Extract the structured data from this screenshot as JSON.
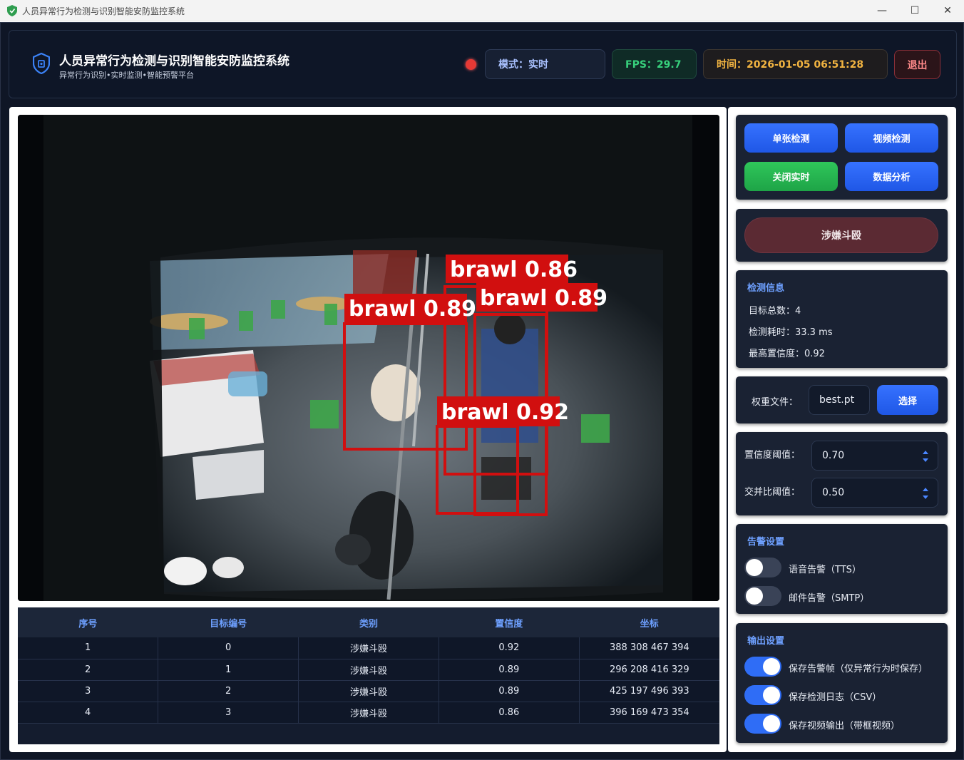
{
  "window": {
    "title": "人员异常行为检测与识别智能安防监控系统",
    "minimize_glyph": "—",
    "maximize_glyph": "☐",
    "close_glyph": "✕"
  },
  "header": {
    "title": "人员异常行为检测与识别智能安防监控系统",
    "subtitle": "异常行为识别•实时监测•智能预警平台",
    "mode": "模式：实时",
    "fps": "FPS：29.7",
    "time": "时间：2026-01-05 06:51:28",
    "exit_label": "退出"
  },
  "video": {
    "detections": [
      {
        "label": "brawl 0.86"
      },
      {
        "label": "brawl 0.89"
      },
      {
        "label": "brawl 0.89"
      },
      {
        "label": "brawl 0.92"
      }
    ]
  },
  "table": {
    "headers": [
      "序号",
      "目标编号",
      "类别",
      "置信度",
      "坐标"
    ],
    "rows": [
      [
        "1",
        "0",
        "涉嫌斗殴",
        "0.92",
        "388 308 467 394"
      ],
      [
        "2",
        "1",
        "涉嫌斗殴",
        "0.89",
        "296 208 416 329"
      ],
      [
        "3",
        "2",
        "涉嫌斗殴",
        "0.89",
        "425 197 496 393"
      ],
      [
        "4",
        "3",
        "涉嫌斗殴",
        "0.86",
        "396 169 473 354"
      ]
    ]
  },
  "controls": {
    "single_detect": "单张检测",
    "video_detect": "视频检测",
    "close_realtime": "关闭实时",
    "data_analysis": "数据分析"
  },
  "alarm": {
    "text": "涉嫌斗殴"
  },
  "detection_info": {
    "title": "检测信息",
    "total": "目标总数：4",
    "elapsed": "检测耗时：33.3 ms",
    "max_conf": "最高置信度：0.92"
  },
  "weights": {
    "label": "权重文件：",
    "value": "best.pt",
    "choose": "选择"
  },
  "thresholds": {
    "conf_label": "置信度阈值：",
    "conf_value": "0.70",
    "iou_label": "交并比阈值：",
    "iou_value": "0.50"
  },
  "alert_settings": {
    "title": "告警设置",
    "items": [
      {
        "label": "语音告警（TTS）",
        "enabled": false
      },
      {
        "label": "邮件告警（SMTP）",
        "enabled": false
      }
    ]
  },
  "output_settings": {
    "title": "输出设置",
    "items": [
      {
        "label": "保存告警帧（仅异常行为时保存）",
        "enabled": true
      },
      {
        "label": "保存检测日志（CSV）",
        "enabled": true
      },
      {
        "label": "保存视频输出（带框视频）",
        "enabled": true
      }
    ]
  },
  "colors": {
    "accent_blue": "#2f6df6",
    "fps_green": "#37d07c",
    "time_amber": "#f2b441",
    "bbox_red": "#d10f0f"
  }
}
